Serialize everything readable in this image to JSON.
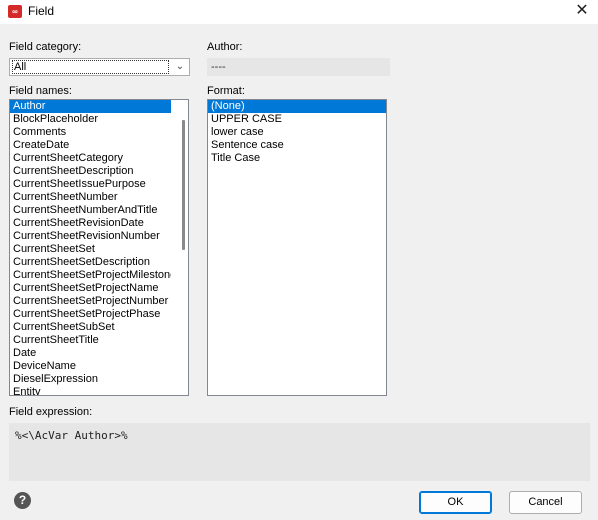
{
  "window": {
    "title": "Field",
    "close_glyph": "✕"
  },
  "labels": {
    "field_category": "Field category:",
    "author": "Author:",
    "field_names": "Field names:",
    "format": "Format:",
    "field_expression": "Field expression:"
  },
  "category": {
    "selected": "All"
  },
  "author_value": "----",
  "field_names": [
    "Author",
    "BlockPlaceholder",
    "Comments",
    "CreateDate",
    "CurrentSheetCategory",
    "CurrentSheetDescription",
    "CurrentSheetIssuePurpose",
    "CurrentSheetNumber",
    "CurrentSheetNumberAndTitle",
    "CurrentSheetRevisionDate",
    "CurrentSheetRevisionNumber",
    "CurrentSheetSet",
    "CurrentSheetSetDescription",
    "CurrentSheetSetProjectMilestone",
    "CurrentSheetSetProjectName",
    "CurrentSheetSetProjectNumber",
    "CurrentSheetSetProjectPhase",
    "CurrentSheetSubSet",
    "CurrentSheetTitle",
    "Date",
    "DeviceName",
    "DieselExpression",
    "Entity"
  ],
  "selected_field_index": 0,
  "formats": [
    "(None)",
    "UPPER CASE",
    "lower case",
    "Sentence case",
    "Title Case"
  ],
  "selected_format_index": 0,
  "expression": "%<\\AcVar Author>%",
  "buttons": {
    "ok": "OK",
    "cancel": "Cancel",
    "help": "?"
  },
  "colors": {
    "selection": "#0078d7",
    "accent_icon": "#d42a2a"
  }
}
